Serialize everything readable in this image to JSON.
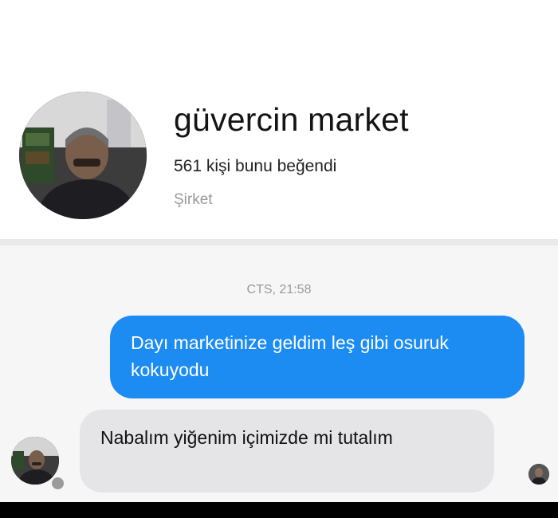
{
  "profile": {
    "name": "güvercin market",
    "likes": "561 kişi bunu beğendi",
    "category": "Şirket"
  },
  "conversation": {
    "timestamp": "CTS, 21:58",
    "messages": [
      {
        "direction": "outgoing",
        "text": "Dayı marketinize geldim leş gibi osuruk kokuyodu"
      },
      {
        "direction": "incoming",
        "text": "Nabalım yiğenim içimizde mi tutalım"
      }
    ]
  },
  "colors": {
    "outgoing_bubble": "#1c8cf3",
    "incoming_bubble": "#e5e5e8"
  },
  "icons": {
    "profile_avatar": "profile-avatar-photo",
    "sender_avatar": "sender-avatar-photo",
    "read_receipt": "read-receipt-avatar"
  }
}
